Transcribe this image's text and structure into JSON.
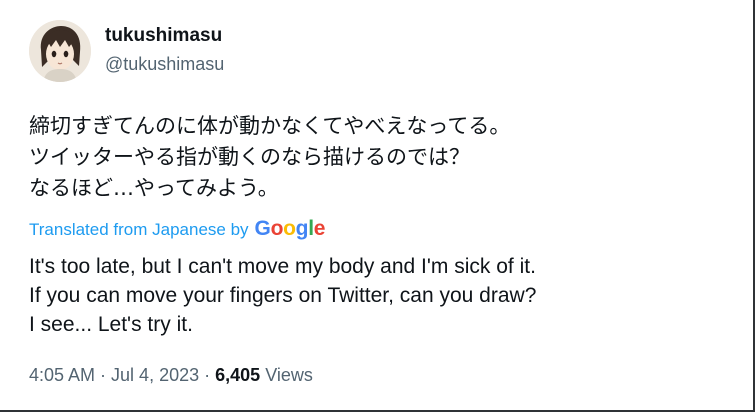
{
  "tweet": {
    "author": {
      "display_name": "tukushimasu",
      "handle": "@tukushimasu"
    },
    "original_text": "締切すぎてんのに体が動かなくてやべえなってる。\nツイッターやる指が動くのなら描けるのでは？\nなるほど…やってみよう。",
    "translation": {
      "label": "Translated from Japanese by",
      "provider_letters": [
        "G",
        "o",
        "o",
        "g",
        "l",
        "e"
      ],
      "text": "It's too late, but I can't move my body and I'm sick of it.\nIf you can move your fingers on Twitter, can you draw?\nI see... Let's try it."
    },
    "meta": {
      "time": "4:05 AM",
      "separator": "·",
      "date": "Jul 4, 2023",
      "views_count": "6,405",
      "views_label": "Views"
    }
  },
  "colors": {
    "link": "#1d9bf0",
    "text": "#0f1419",
    "secondary": "#536471",
    "google": [
      "#4285F4",
      "#EA4335",
      "#FBBC05",
      "#4285F4",
      "#34A853",
      "#EA4335"
    ]
  }
}
